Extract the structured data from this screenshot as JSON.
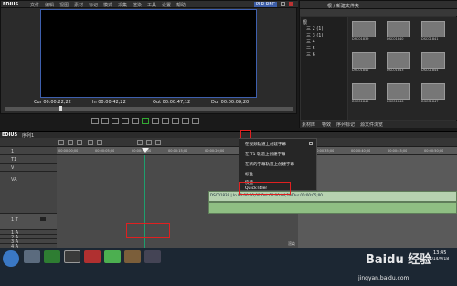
{
  "app": {
    "title": "EDIUS"
  },
  "preview": {
    "menu": [
      "文件",
      "编辑",
      "视图",
      "素材",
      "标记",
      "模式",
      "采集",
      "渲染",
      "工具",
      "设置",
      "帮助"
    ],
    "mode_badge": "PLR REC",
    "cur_label": "Cur",
    "cur_time": "00:00:22;22",
    "in_label": "In",
    "in_time": "00:00:42;22",
    "out_label": "Out",
    "out_time": "00:00:47;12",
    "dur_label": "Dur",
    "dur_time": "00:00:09;20"
  },
  "bin": {
    "path": "根 / 新建文件夹",
    "tree": [
      "根",
      "三 2 (1)",
      "三 3 (1)",
      "三 4",
      "三 5",
      "三 6"
    ],
    "clips": [
      {
        "name": "DSC01839"
      },
      {
        "name": "DSC01840"
      },
      {
        "name": "DSC01841"
      },
      {
        "name": "DSC01842"
      },
      {
        "name": "DSC01843"
      },
      {
        "name": "DSC01844"
      },
      {
        "name": "DSC01845"
      },
      {
        "name": "DSC01846"
      },
      {
        "name": "DSC01847"
      }
    ],
    "tabs": [
      "素材库",
      "特效",
      "序列标记",
      "源文件浏览"
    ]
  },
  "timeline": {
    "title": "EDIUS",
    "sequence": "序列1",
    "tracks": [
      {
        "label": "1"
      },
      {
        "label": "T1"
      },
      {
        "label": "V"
      },
      {
        "label": "VA"
      },
      {
        "label": "1 T"
      },
      {
        "label": "1 A"
      },
      {
        "label": "2 A"
      },
      {
        "label": "3 A"
      },
      {
        "label": "4 A"
      }
    ],
    "ruler_ticks": [
      "00:00:00;00",
      "00:00:05;00",
      "00:00:10;00",
      "00:00:15;00",
      "00:00:20;00",
      "00:00:25;00",
      "00:00:30;00",
      "00:00:35;00",
      "00:00:40;00",
      "00:00:45;00",
      "00:00:50;00"
    ],
    "clip_label": "DSC01839 | In 00:00:00;00 Out 00:00:04;29 Dur 00:00:05;00"
  },
  "context_menu": {
    "items": [
      "在视频轨道上创建字幕",
      "在 T1 轨道上创建字幕",
      "在新的字幕轨道上创建字幕",
      "标准",
      "快速",
      "QuickTitler"
    ]
  },
  "statusbar": {
    "text": "渲染"
  },
  "taskbar": {
    "time": "13:45",
    "date": "2014/9/18",
    "watermark": "Baidu 经验",
    "watermark_url": "jingyan.baidu.com"
  },
  "colors": {
    "timeline_bg": "#3a3a3a",
    "clip": "#b6d2b0",
    "playhead": "#1e9f6e",
    "highlight_box": "#e02020",
    "preview_border": "#3e5fae"
  }
}
